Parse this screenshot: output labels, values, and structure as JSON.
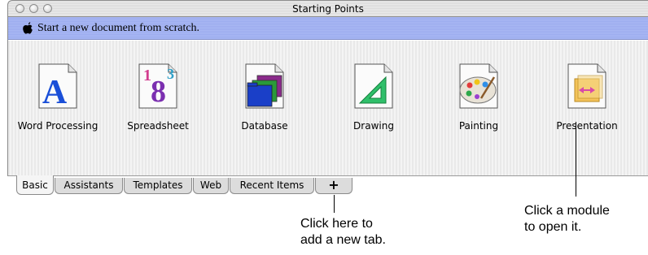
{
  "window": {
    "title": "Starting Points"
  },
  "banner": {
    "text": "Start a new document from scratch.",
    "icon": "apple-icon"
  },
  "modules": [
    {
      "label": "Word Processing",
      "icon": "word-processing-icon"
    },
    {
      "label": "Spreadsheet",
      "icon": "spreadsheet-icon"
    },
    {
      "label": "Database",
      "icon": "database-icon"
    },
    {
      "label": "Drawing",
      "icon": "drawing-icon"
    },
    {
      "label": "Painting",
      "icon": "painting-icon"
    },
    {
      "label": "Presentation",
      "icon": "presentation-icon"
    }
  ],
  "tabs": [
    {
      "label": "Basic",
      "selected": true
    },
    {
      "label": "Assistants",
      "selected": false
    },
    {
      "label": "Templates",
      "selected": false
    },
    {
      "label": "Web",
      "selected": false
    },
    {
      "label": "Recent Items",
      "selected": false
    },
    {
      "label": "+",
      "selected": false
    }
  ],
  "callouts": {
    "add_tab": [
      "Click here to",
      "add a new tab."
    ],
    "module": [
      "Click a module",
      "to open it."
    ]
  },
  "colors": {
    "banner": "#a9b8f4",
    "panel": "#efefef"
  }
}
